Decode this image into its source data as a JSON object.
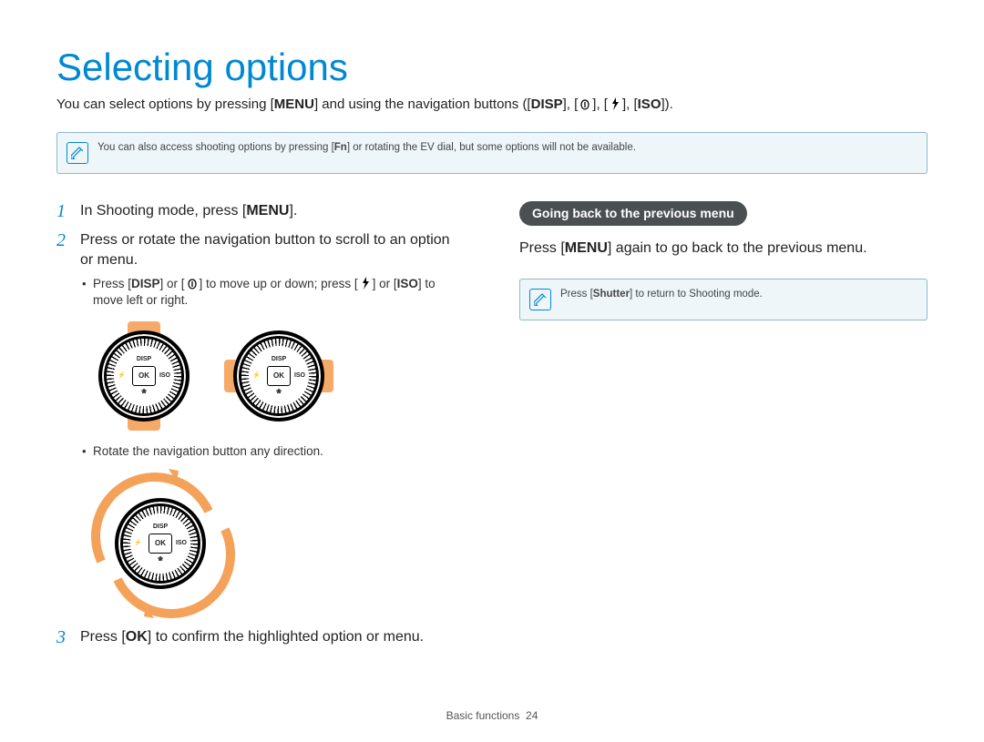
{
  "title": "Selecting options",
  "intro": {
    "pre": "You can select options by pressing [",
    "menu": "MENU",
    "mid": "] and using the navigation buttons ([",
    "disp": "DISP",
    "sep1": "], [",
    "sep2": "], [",
    "sep3": "], [",
    "iso": "ISO",
    "post": "])."
  },
  "tip1": {
    "pre": "You can also access shooting options by pressing [",
    "fn": "Fn",
    "post": "] or rotating the EV dial, but some options will not be available."
  },
  "steps": {
    "s1": {
      "num": "1",
      "pre": "In Shooting mode, press [",
      "menu": "MENU",
      "post": "]."
    },
    "s2": {
      "num": "2",
      "text": "Press or rotate the navigation button to scroll to an option or menu.",
      "sub1": {
        "a": "Press [",
        "disp": "DISP",
        "b": "] or [",
        "c": "] to move up or down; press [",
        "d": "] or [",
        "iso": "ISO",
        "e": "] to move left or right."
      },
      "sub2": "Rotate the navigation button any direction."
    },
    "s3": {
      "num": "3",
      "pre": "Press [",
      "ok": "OK",
      "post": "] to confirm the highlighted option or menu."
    }
  },
  "dial": {
    "top": "DISP",
    "left": "⚡",
    "right": "ISO",
    "bottom": "❀",
    "ok": "OK"
  },
  "right": {
    "pill": "Going back to the previous menu",
    "para": {
      "pre": "Press [",
      "menu": "MENU",
      "post": "] again to go back to the previous menu."
    },
    "tip": {
      "pre": "Press [",
      "shutter": "Shutter",
      "post": "] to return to Shooting mode."
    }
  },
  "footer": {
    "label": "Basic functions",
    "page": "24"
  }
}
